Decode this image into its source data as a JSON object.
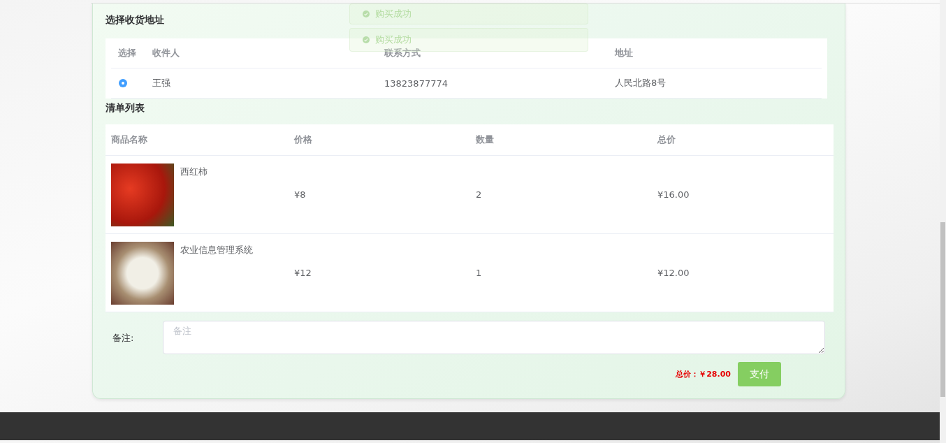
{
  "toasts": [
    {
      "text": "购买成功"
    },
    {
      "text": "购买成功"
    }
  ],
  "address": {
    "title": "选择收货地址",
    "columns": [
      "选择",
      "收件人",
      "联系方式",
      "地址"
    ],
    "rows": [
      {
        "selected": true,
        "name": "王强",
        "phone": "13823877774",
        "address": "人民北路8号"
      }
    ]
  },
  "goods": {
    "title": "清单列表",
    "columns": [
      "商品名称",
      "价格",
      "数量",
      "总价"
    ],
    "rows": [
      {
        "name": "西红柿",
        "price": "¥8",
        "qty": "2",
        "total": "¥16.00"
      },
      {
        "name": "农业信息管理系统",
        "price": "¥12",
        "qty": "1",
        "total": "¥12.00"
      }
    ]
  },
  "remark": {
    "label": "备注:",
    "placeholder": "备注"
  },
  "total": "总价：￥28.00",
  "pay_button": "支付"
}
